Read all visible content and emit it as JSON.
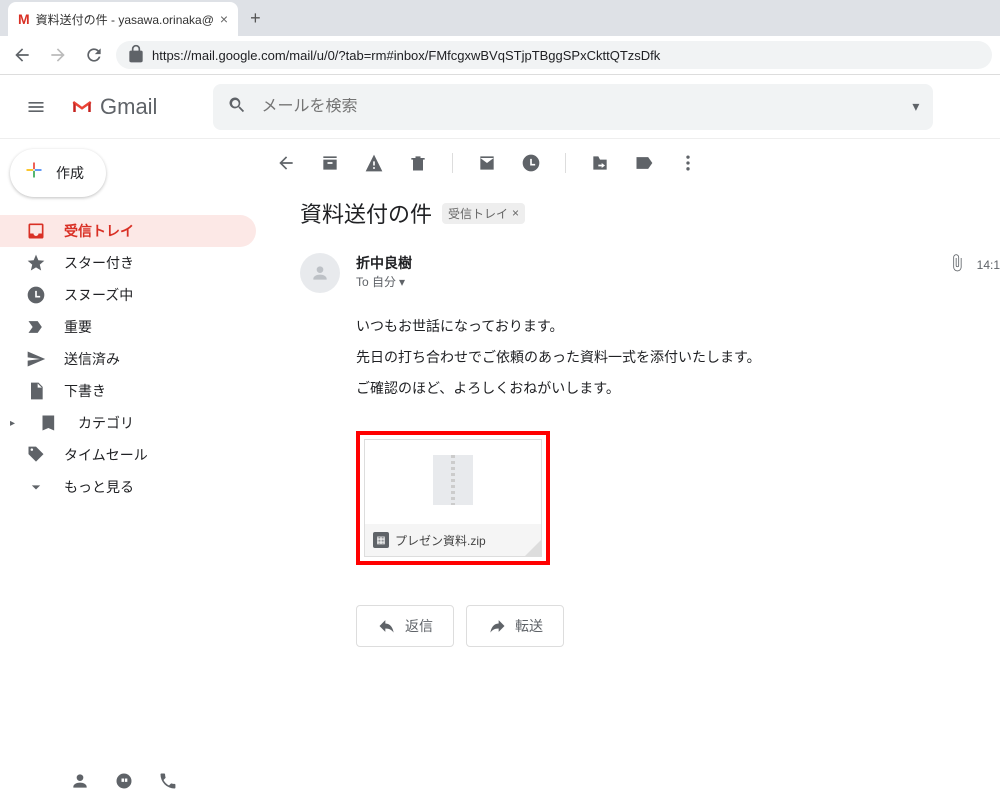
{
  "browser": {
    "tab_title": "資料送付の件 - yasawa.orinaka@",
    "url": "https://mail.google.com/mail/u/0/?tab=rm#inbox/FMfcgxwBVqSTjpTBggSPxCkttQTzsDfk"
  },
  "header": {
    "product": "Gmail",
    "search_placeholder": "メールを検索"
  },
  "compose_label": "作成",
  "sidebar": {
    "items": [
      {
        "label": "受信トレイ"
      },
      {
        "label": "スター付き"
      },
      {
        "label": "スヌーズ中"
      },
      {
        "label": "重要"
      },
      {
        "label": "送信済み"
      },
      {
        "label": "下書き"
      },
      {
        "label": "カテゴリ"
      },
      {
        "label": "タイムセール"
      },
      {
        "label": "もっと見る"
      }
    ]
  },
  "mail": {
    "subject": "資料送付の件",
    "label_chip": "受信トレイ",
    "sender_name": "折中良樹",
    "to_line": "To 自分",
    "time": "14:1",
    "body_lines": [
      "いつもお世話になっております。",
      "先日の打ち合わせでご依頼のあった資料一式を添付いたします。",
      "ご確認のほど、よろしくおねがいします。"
    ],
    "attachment_name": "プレゼン資料.zip",
    "reply_label": "返信",
    "forward_label": "転送"
  }
}
